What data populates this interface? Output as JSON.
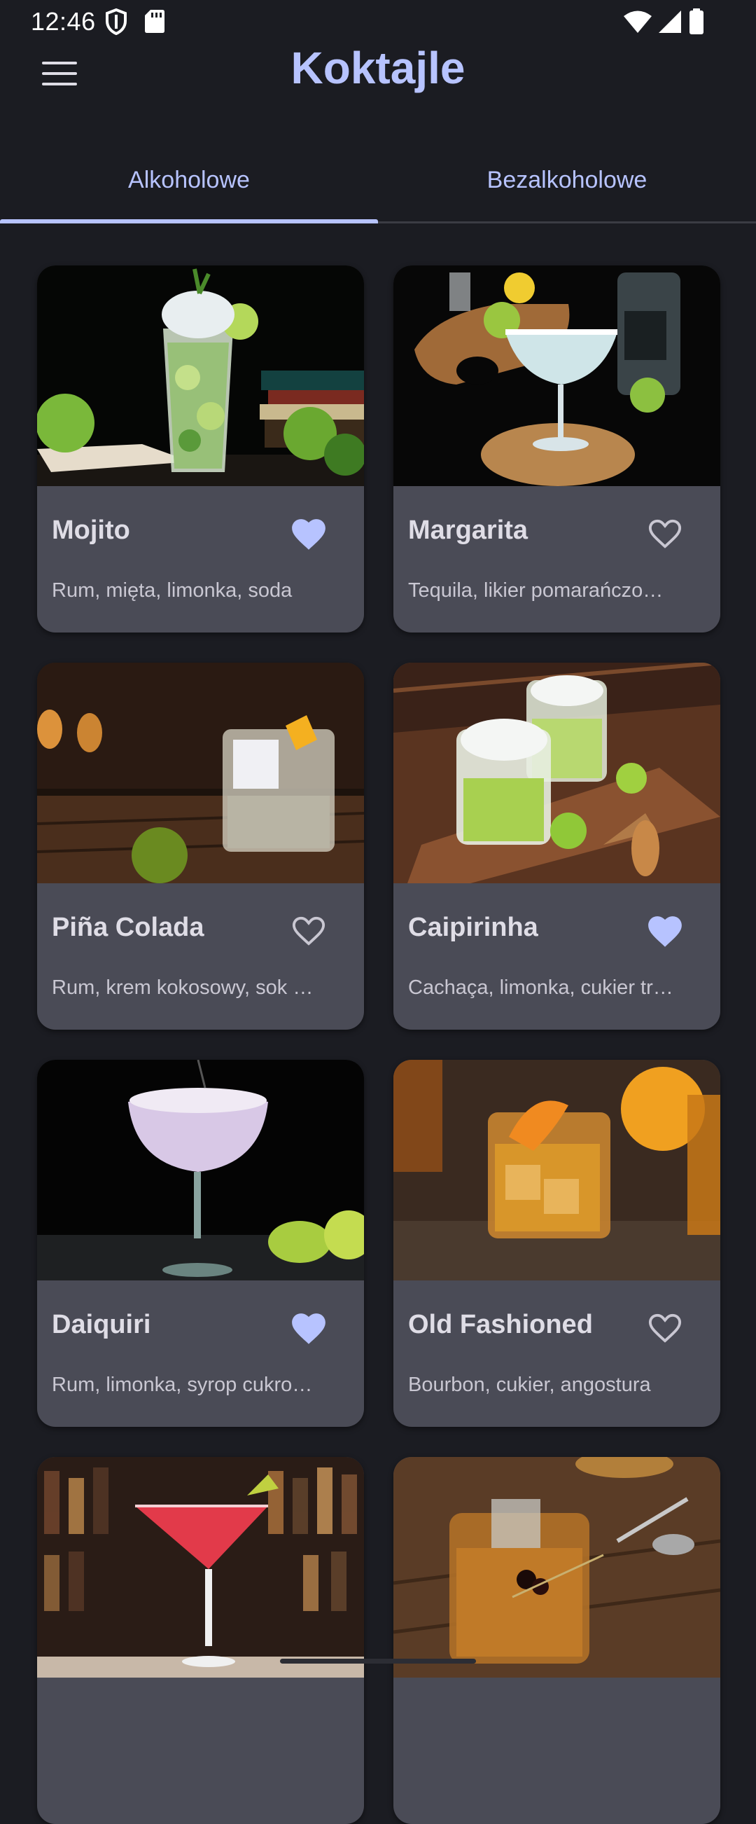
{
  "status_bar": {
    "time": "12:46",
    "icons": [
      "shield-icon",
      "sd-card-icon",
      "wifi-icon",
      "signal-icon",
      "battery-icon"
    ]
  },
  "app_bar": {
    "title": "Koktajle",
    "menu_icon": "menu-icon"
  },
  "tabs": [
    {
      "label": "Alkoholowe",
      "selected": true
    },
    {
      "label": "Bezalkoholowe",
      "selected": false
    }
  ],
  "cocktails": [
    {
      "name": "Mojito",
      "ingredients": "Rum, mięta, limonka, soda",
      "favorite": true
    },
    {
      "name": "Margarita",
      "ingredients": "Tequila, likier pomarańczo…",
      "favorite": false
    },
    {
      "name": "Piña Colada",
      "ingredients": "Rum, krem kokosowy, sok …",
      "favorite": false
    },
    {
      "name": "Caipirinha",
      "ingredients": "Cachaça, limonka, cukier tr…",
      "favorite": true
    },
    {
      "name": "Daiquiri",
      "ingredients": "Rum, limonka, syrop cukro…",
      "favorite": true
    },
    {
      "name": "Old Fashioned",
      "ingredients": "Bourbon, cukier, angostura",
      "favorite": false
    },
    {
      "name": "",
      "ingredients": "",
      "favorite": false
    },
    {
      "name": "",
      "ingredients": "",
      "favorite": false
    }
  ],
  "colors": {
    "background": "#1b1c22",
    "accent": "#b7c3ff",
    "card": "#4a4b56",
    "favorite": "#b7c3ff"
  }
}
